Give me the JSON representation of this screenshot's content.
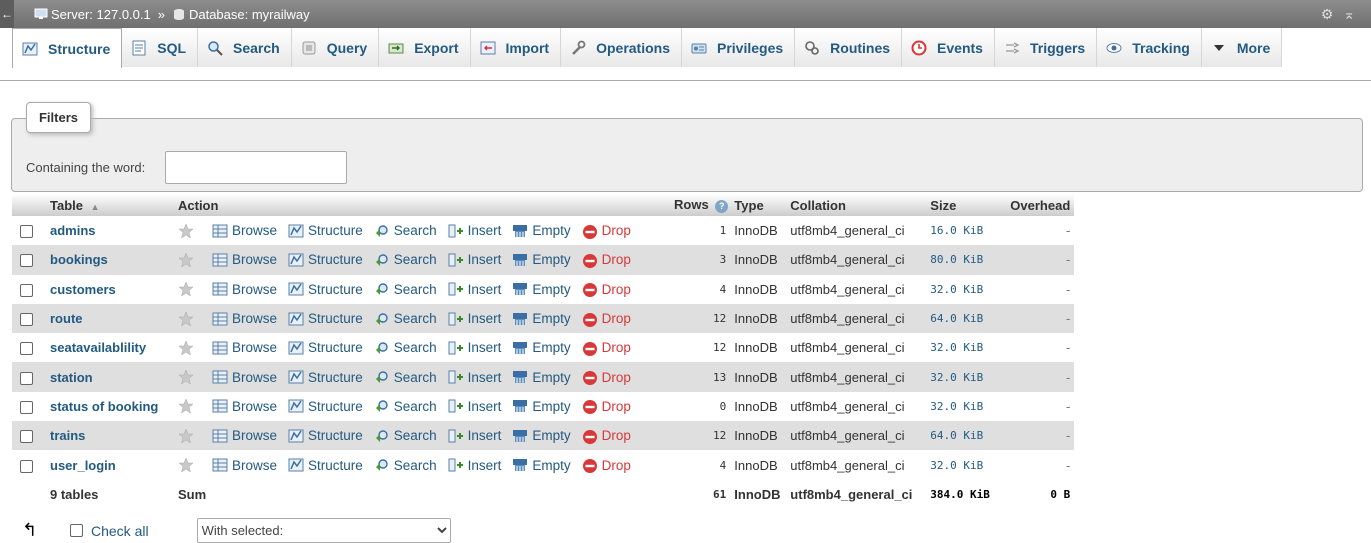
{
  "topbar": {
    "server": "Server: 127.0.0.1",
    "separator": "»",
    "database": "Database: myrailway"
  },
  "tabs": [
    {
      "label": "Structure",
      "icon": "structure-icon"
    },
    {
      "label": "SQL",
      "icon": "sql-icon"
    },
    {
      "label": "Search",
      "icon": "search-icon"
    },
    {
      "label": "Query",
      "icon": "query-icon"
    },
    {
      "label": "Export",
      "icon": "export-icon"
    },
    {
      "label": "Import",
      "icon": "import-icon"
    },
    {
      "label": "Operations",
      "icon": "wrench-icon"
    },
    {
      "label": "Privileges",
      "icon": "privileges-icon"
    },
    {
      "label": "Routines",
      "icon": "routines-icon"
    },
    {
      "label": "Events",
      "icon": "clock-icon"
    },
    {
      "label": "Triggers",
      "icon": "triggers-icon"
    },
    {
      "label": "Tracking",
      "icon": "eye-icon"
    },
    {
      "label": "More",
      "icon": "caret-down-icon"
    }
  ],
  "filters": {
    "legend": "Filters",
    "label": "Containing the word:",
    "value": ""
  },
  "table": {
    "headers": {
      "table": "Table",
      "action": "Action",
      "rows": "Rows",
      "type": "Type",
      "collation": "Collation",
      "size": "Size",
      "overhead": "Overhead"
    },
    "actions": [
      "Browse",
      "Structure",
      "Search",
      "Insert",
      "Empty",
      "Drop"
    ],
    "rows": [
      {
        "name": "admins",
        "rows": "1",
        "type": "InnoDB",
        "collation": "utf8mb4_general_ci",
        "size": "16.0 KiB",
        "overhead": "-"
      },
      {
        "name": "bookings",
        "rows": "3",
        "type": "InnoDB",
        "collation": "utf8mb4_general_ci",
        "size": "80.0 KiB",
        "overhead": "-"
      },
      {
        "name": "customers",
        "rows": "4",
        "type": "InnoDB",
        "collation": "utf8mb4_general_ci",
        "size": "32.0 KiB",
        "overhead": "-"
      },
      {
        "name": "route",
        "rows": "12",
        "type": "InnoDB",
        "collation": "utf8mb4_general_ci",
        "size": "64.0 KiB",
        "overhead": "-"
      },
      {
        "name": "seatavailablility",
        "rows": "12",
        "type": "InnoDB",
        "collation": "utf8mb4_general_ci",
        "size": "32.0 KiB",
        "overhead": "-"
      },
      {
        "name": "station",
        "rows": "13",
        "type": "InnoDB",
        "collation": "utf8mb4_general_ci",
        "size": "32.0 KiB",
        "overhead": "-"
      },
      {
        "name": "status of booking",
        "rows": "0",
        "type": "InnoDB",
        "collation": "utf8mb4_general_ci",
        "size": "32.0 KiB",
        "overhead": "-"
      },
      {
        "name": "trains",
        "rows": "12",
        "type": "InnoDB",
        "collation": "utf8mb4_general_ci",
        "size": "64.0 KiB",
        "overhead": "-"
      },
      {
        "name": "user_login",
        "rows": "4",
        "type": "InnoDB",
        "collation": "utf8mb4_general_ci",
        "size": "32.0 KiB",
        "overhead": "-"
      }
    ],
    "footer": {
      "count": "9 tables",
      "sum": "Sum",
      "rows": "61",
      "type": "InnoDB",
      "collation": "utf8mb4_general_ci",
      "size": "384.0 KiB",
      "overhead": "0 B"
    }
  },
  "bottom": {
    "check_all": "Check all",
    "with_selected": "With selected:"
  },
  "colors": {
    "link": "#235a81",
    "drop": "#d93838",
    "row_alt": "#dfdfdf"
  }
}
